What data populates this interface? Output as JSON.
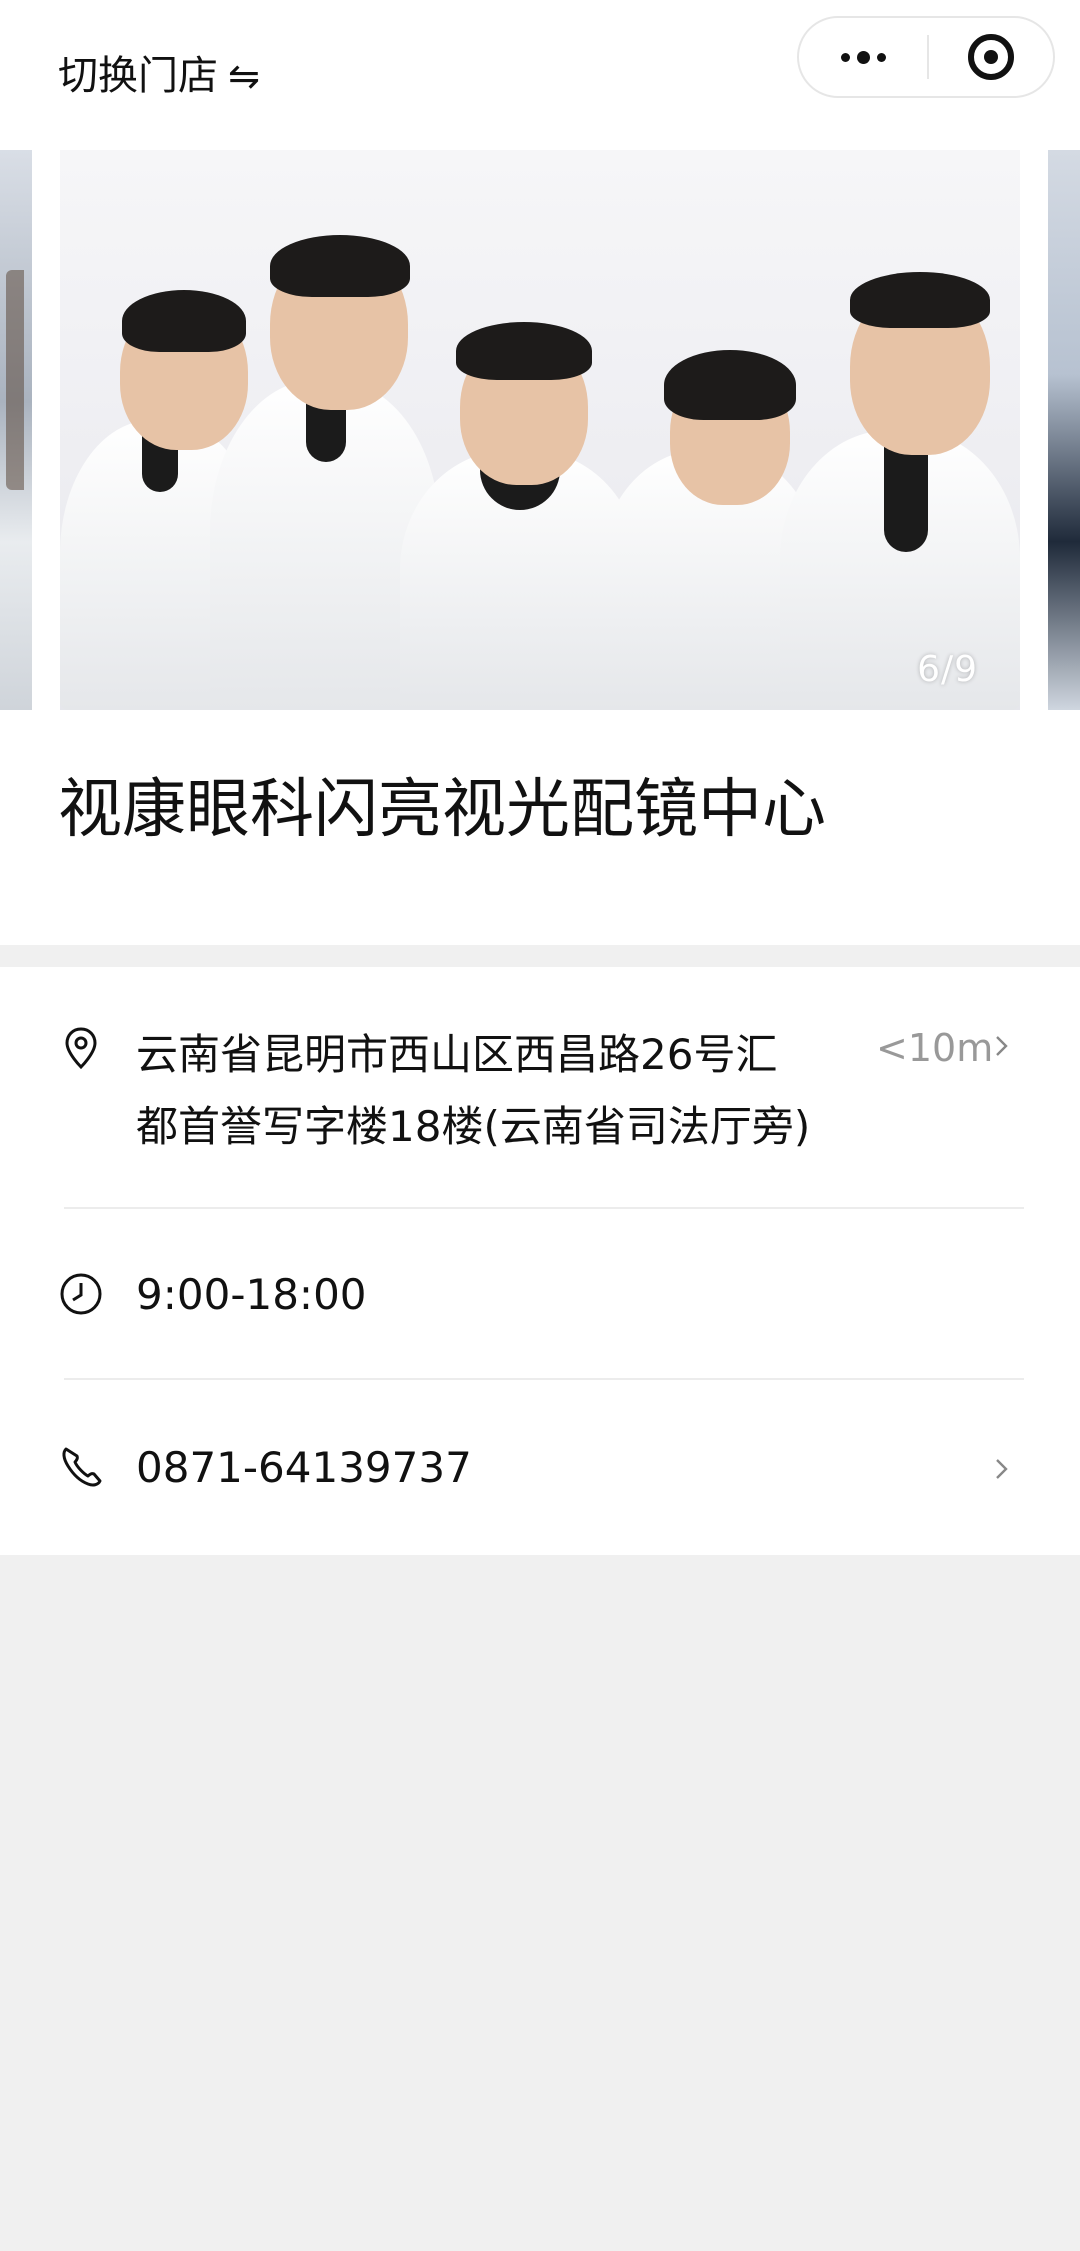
{
  "nav": {
    "switch_store_label": "切换门店",
    "switch_icon": "⇋"
  },
  "carousel": {
    "current": 6,
    "total": 9,
    "counter_text": "6/9"
  },
  "store": {
    "name": "视康眼科闪亮视光配镜中心"
  },
  "info": {
    "address_line1": "云南省昆明市西山区西昌路26号汇",
    "address_line2": "都首誉写字楼18楼(云南省司法厅旁)",
    "distance": "<10m",
    "hours": "9:00-18:00",
    "phone": "0871-64139737"
  },
  "colors": {
    "page_bg": "#f0f0f0",
    "card_bg": "#ffffff",
    "text": "#111111",
    "muted": "#999999"
  }
}
